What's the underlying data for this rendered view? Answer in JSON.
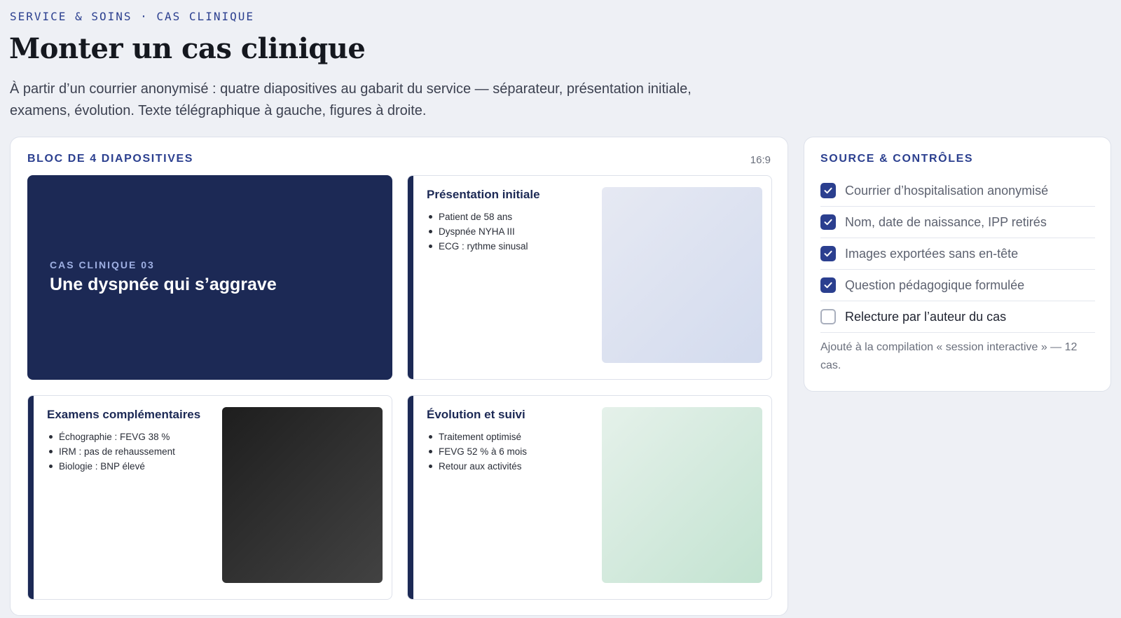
{
  "header": {
    "eyebrow": "SERVICE & SOINS · CAS CLINIQUE",
    "title": "Monter un cas clinique",
    "lede": "À partir d’un courrier anonymisé : quatre diapositives au gabarit du service — séparateur, présentation initiale, examens, évolution. Texte télégraphique à gauche, figures à droite."
  },
  "slides_panel": {
    "heading": "BLOC DE 4 DIAPOSITIVES",
    "ratio": "16:9",
    "separator": {
      "kicker": "CAS CLINIQUE 03",
      "title": "Une dyspnée qui s’aggrave"
    },
    "slides": [
      {
        "title": "Présentation initiale",
        "bullets": [
          "Patient de 58 ans",
          "Dyspnée NYHA III",
          "ECG : rythme sinusal"
        ],
        "figure_color": "#dde3f1"
      },
      {
        "title": "Examens complémentaires",
        "bullets": [
          "Échographie : FEVG 38 %",
          "IRM : pas de rehaussement",
          "Biologie : BNP élevé"
        ],
        "figure_color": "#2e2e2e"
      },
      {
        "title": "Évolution et suivi",
        "bullets": [
          "Traitement optimisé",
          "FEVG 52 % à 6 mois",
          "Retour aux activités"
        ],
        "figure_color": "#d4eadd"
      }
    ]
  },
  "side_panel": {
    "heading": "SOURCE & CONTRÔLES",
    "checks": [
      {
        "label": "Courrier d’hospitalisation anonymisé",
        "checked": true
      },
      {
        "label": "Nom, date de naissance, IPP retirés",
        "checked": true
      },
      {
        "label": "Images exportées sans en-tête",
        "checked": true
      },
      {
        "label": "Question pédagogique formulée",
        "checked": true
      },
      {
        "label": "Relecture par l’auteur du cas",
        "checked": false
      }
    ],
    "note": "Ajouté à la compilation « session interactive » — 12 cas."
  },
  "colors": {
    "accent": "#2b3f8f",
    "slide_navy": "#1c2955",
    "background": "#eef0f5"
  }
}
